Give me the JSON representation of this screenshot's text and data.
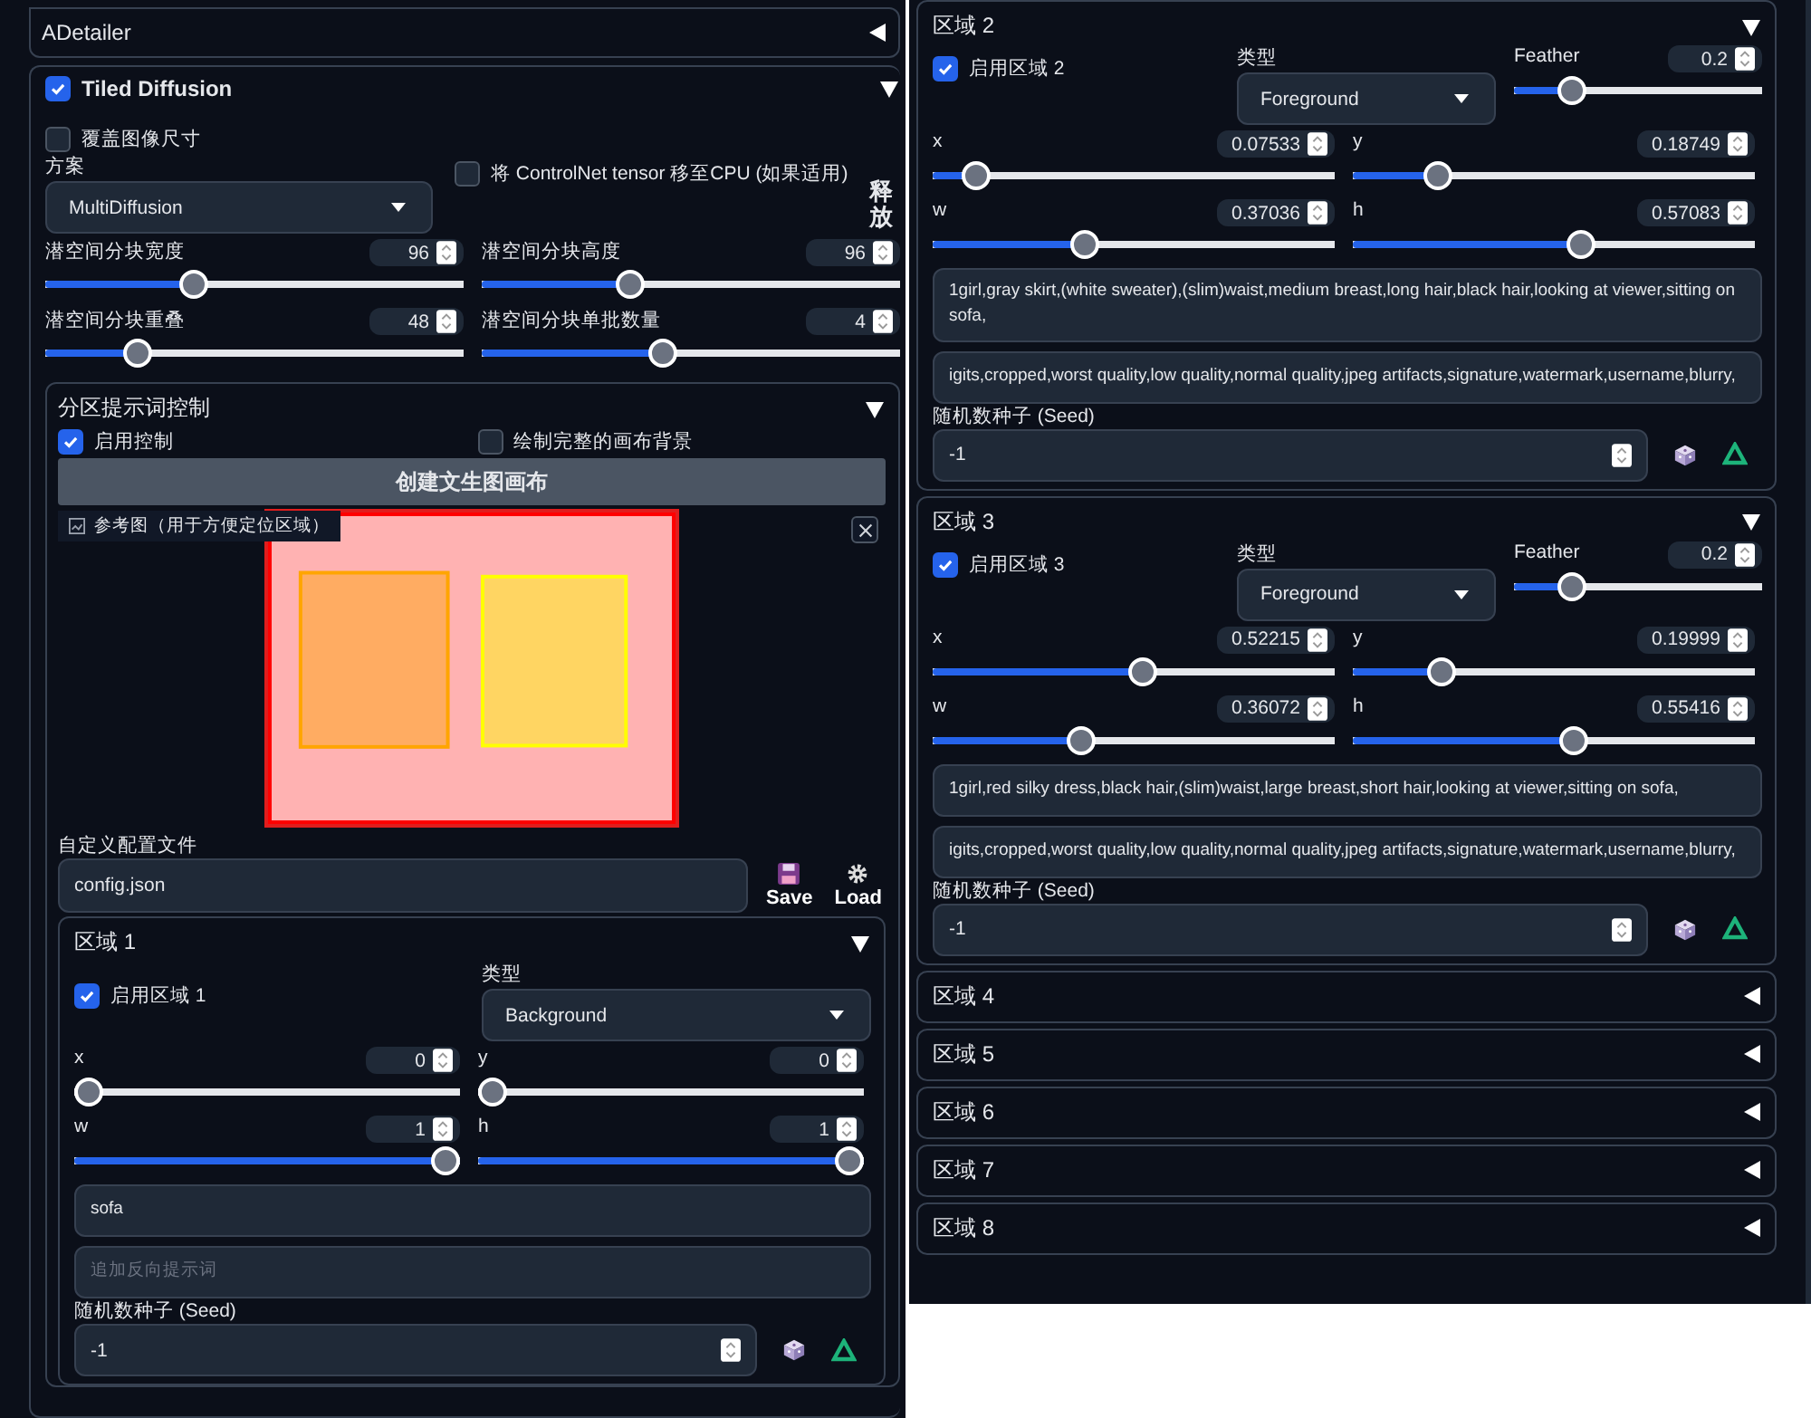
{
  "adetailer": {
    "title": "ADetailer",
    "expanded": false
  },
  "tiled_diffusion": {
    "title": "Tiled Diffusion",
    "checked": true,
    "expanded": true,
    "overwrite": {
      "label": "覆盖图像尺寸",
      "checked": false
    },
    "method": {
      "label": "方案",
      "value": "MultiDiffusion"
    },
    "move_to_cpu": {
      "label": "将 ControlNet tensor 移至CPU (如果适用)",
      "checked": false
    },
    "side_text": "释放",
    "sliders": [
      {
        "label": "潜空间分块宽度",
        "value": "96",
        "level": 0.345
      },
      {
        "label": "潜空间分块高度",
        "value": "96",
        "level": 0.345
      },
      {
        "label": "潜空间分块重叠",
        "value": "48",
        "level": 0.2
      },
      {
        "label": "潜空间分块单批数量",
        "value": "4",
        "level": 0.43
      }
    ]
  },
  "region_control": {
    "title": "分区提示词控制",
    "expanded": true,
    "enable": {
      "label": "启用控制",
      "checked": true
    },
    "draw_background": {
      "label": "绘制完整的画布背景",
      "checked": false
    },
    "create_button": "创建文生图画布",
    "reference_label": "参考图（用于方便定位区域）",
    "config": {
      "label": "自定义配置文件",
      "value": "config.json"
    },
    "save_button": "Save",
    "load_button": "Load"
  },
  "regions": [
    {
      "title": "区域 1",
      "expanded": true,
      "color": "#ff0000",
      "enable": {
        "label": "启用区域 1",
        "checked": true
      },
      "type": {
        "label": "类型",
        "value": "Background"
      },
      "sliders": [
        {
          "label": "x",
          "value": "0",
          "level": 0
        },
        {
          "label": "y",
          "value": "0",
          "level": 0
        },
        {
          "label": "w",
          "value": "1",
          "level": 1
        },
        {
          "label": "h",
          "value": "1",
          "level": 1
        }
      ],
      "prompt": "sofa",
      "negative": {
        "placeholder": "追加反向提示词"
      },
      "seed": {
        "label": "随机数种子 (Seed)",
        "value": "-1"
      }
    },
    {
      "title": "区域 2",
      "expanded": true,
      "color": "#ffa500",
      "enable": {
        "label": "启用区域 2",
        "checked": true
      },
      "type": {
        "label": "类型",
        "value": "Foreground"
      },
      "feather": {
        "label": "Feather",
        "value": "0.2",
        "level": 0.2
      },
      "sliders": [
        {
          "label": "x",
          "value": "0.07533",
          "level": 0.0753
        },
        {
          "label": "y",
          "value": "0.18749",
          "level": 0.1875
        },
        {
          "label": "w",
          "value": "0.37036",
          "level": 0.3704
        },
        {
          "label": "h",
          "value": "0.57083",
          "level": 0.5708
        }
      ],
      "prompt": "1girl,gray skirt,(white sweater),(slim)waist,medium breast,long hair,black hair,looking at viewer,sitting on sofa,",
      "negative": {
        "value": "igits,cropped,worst quality,low quality,normal quality,jpeg artifacts,signature,watermark,username,blurry,"
      },
      "seed": {
        "label": "随机数种子 (Seed)",
        "value": "-1"
      }
    },
    {
      "title": "区域 3",
      "expanded": true,
      "color": "#ffff00",
      "enable": {
        "label": "启用区域 3",
        "checked": true
      },
      "type": {
        "label": "类型",
        "value": "Foreground"
      },
      "feather": {
        "label": "Feather",
        "value": "0.2",
        "level": 0.2
      },
      "sliders": [
        {
          "label": "x",
          "value": "0.52215",
          "level": 0.5222
        },
        {
          "label": "y",
          "value": "0.19999",
          "level": 0.2
        },
        {
          "label": "w",
          "value": "0.36072",
          "level": 0.3607
        },
        {
          "label": "h",
          "value": "0.55416",
          "level": 0.5542
        }
      ],
      "prompt": "1girl,red silky dress,black hair,(slim)waist,large breast,short hair,looking at viewer,sitting on sofa,",
      "negative": {
        "value": "igits,cropped,worst quality,low quality,normal quality,jpeg artifacts,signature,watermark,username,blurry,"
      },
      "seed": {
        "label": "随机数种子 (Seed)",
        "value": "-1"
      }
    },
    {
      "title": "区域 4",
      "expanded": false
    },
    {
      "title": "区域 5",
      "expanded": false
    },
    {
      "title": "区域 6",
      "expanded": false
    },
    {
      "title": "区域 7",
      "expanded": false
    },
    {
      "title": "区域 8",
      "expanded": false
    }
  ]
}
